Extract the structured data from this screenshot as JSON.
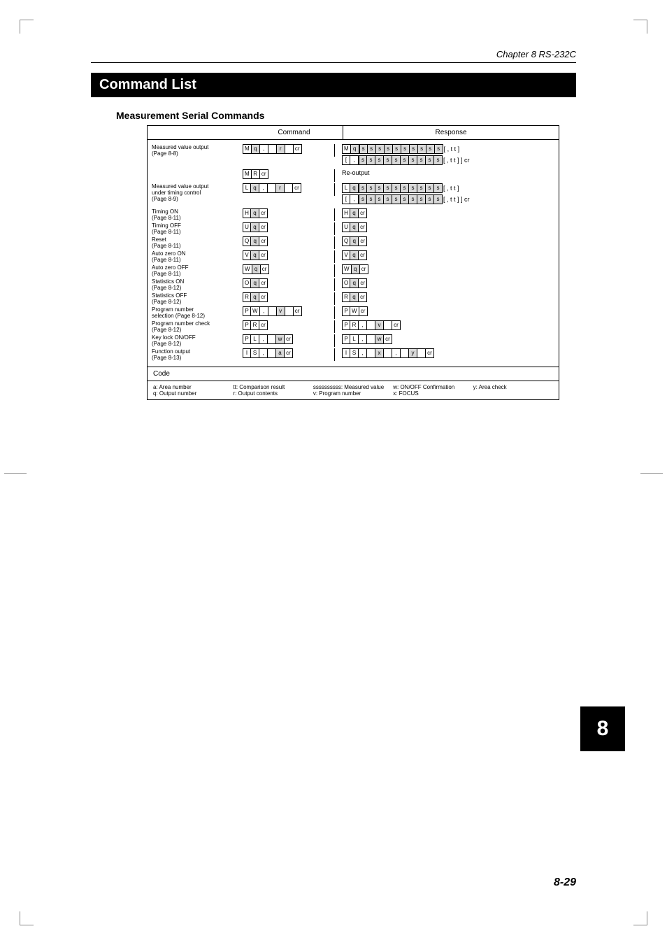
{
  "chapter": "Chapter 8  RS-232C",
  "title": "Command List",
  "subhead": "Measurement Serial Commands",
  "headers": {
    "cmd": "Command",
    "resp": "Response"
  },
  "rows": [
    {
      "label": "Measured value output\n(Page 8-8)",
      "cmd": [
        [
          "M"
        ],
        [
          "q"
        ],
        [
          ","
        ],
        [
          "sp"
        ],
        [
          "r"
        ],
        [
          "sp"
        ],
        [
          "cr"
        ]
      ],
      "cmd_shade": [
        0,
        1,
        0,
        0,
        1,
        0,
        0
      ],
      "resp_lines": [
        {
          "front": "M q",
          "pattern": "s10",
          "back": "[ , t t ]"
        },
        {
          "front": "[ ,",
          "pattern": "s10",
          "back": "[ , t t ] ] cr"
        }
      ]
    },
    {
      "label": "",
      "cmd": [
        [
          "M"
        ],
        [
          "R"
        ],
        [
          "cr"
        ]
      ],
      "cmd_shade": [
        0,
        0,
        0
      ],
      "resp_text": "Re-output"
    },
    {
      "label": "Measured value output\n  under timing control\n(Page 8-9)",
      "cmd": [
        [
          "L"
        ],
        [
          "q"
        ],
        [
          ","
        ],
        [
          "sp"
        ],
        [
          "r"
        ],
        [
          "sp"
        ],
        [
          "cr"
        ]
      ],
      "cmd_shade": [
        0,
        1,
        0,
        0,
        1,
        0,
        0
      ],
      "resp_lines": [
        {
          "front": "L q",
          "pattern": "s10",
          "back": "[ , t t ]"
        },
        {
          "front": "[ ,",
          "pattern": "s10",
          "back": "[ , t t ] ] cr"
        }
      ]
    },
    {
      "label": "Timing ON\n(Page 8-11)",
      "cmd": [
        [
          "H"
        ],
        [
          "q"
        ],
        [
          "cr"
        ]
      ],
      "cmd_shade": [
        0,
        1,
        0
      ],
      "resp": [
        [
          "H"
        ],
        [
          "q"
        ],
        [
          "cr"
        ]
      ],
      "resp_shade": [
        0,
        1,
        0
      ]
    },
    {
      "label": "Timing OFF\n(Page 8-11)",
      "cmd": [
        [
          "U"
        ],
        [
          "q"
        ],
        [
          "cr"
        ]
      ],
      "cmd_shade": [
        0,
        1,
        0
      ],
      "resp": [
        [
          "U"
        ],
        [
          "q"
        ],
        [
          "cr"
        ]
      ],
      "resp_shade": [
        0,
        1,
        0
      ]
    },
    {
      "label": "Reset\n(Page 8-11)",
      "cmd": [
        [
          "Q"
        ],
        [
          "q"
        ],
        [
          "cr"
        ]
      ],
      "cmd_shade": [
        0,
        1,
        0
      ],
      "resp": [
        [
          "Q"
        ],
        [
          "q"
        ],
        [
          "cr"
        ]
      ],
      "resp_shade": [
        0,
        1,
        0
      ]
    },
    {
      "label": "Auto zero ON\n(Page 8-11)",
      "cmd": [
        [
          "V"
        ],
        [
          "q"
        ],
        [
          "cr"
        ]
      ],
      "cmd_shade": [
        0,
        1,
        0
      ],
      "resp": [
        [
          "V"
        ],
        [
          "q"
        ],
        [
          "cr"
        ]
      ],
      "resp_shade": [
        0,
        1,
        0
      ]
    },
    {
      "label": "Auto zero OFF\n(Page 8-11)",
      "cmd": [
        [
          "W"
        ],
        [
          "q"
        ],
        [
          "cr"
        ]
      ],
      "cmd_shade": [
        0,
        1,
        0
      ],
      "resp": [
        [
          "W"
        ],
        [
          "q"
        ],
        [
          "cr"
        ]
      ],
      "resp_shade": [
        0,
        1,
        0
      ]
    },
    {
      "label": "Statistics ON\n(Page 8-12)",
      "cmd": [
        [
          "O"
        ],
        [
          "q"
        ],
        [
          "cr"
        ]
      ],
      "cmd_shade": [
        0,
        1,
        0
      ],
      "resp": [
        [
          "O"
        ],
        [
          "q"
        ],
        [
          "cr"
        ]
      ],
      "resp_shade": [
        0,
        1,
        0
      ]
    },
    {
      "label": "Statistics OFF\n(Page 8-12)",
      "cmd": [
        [
          "R"
        ],
        [
          "q"
        ],
        [
          "cr"
        ]
      ],
      "cmd_shade": [
        0,
        1,
        0
      ],
      "resp": [
        [
          "R"
        ],
        [
          "q"
        ],
        [
          "cr"
        ]
      ],
      "resp_shade": [
        0,
        1,
        0
      ]
    },
    {
      "label": "Program number\n  selection (Page 8-12)",
      "cmd": [
        [
          "P"
        ],
        [
          "W"
        ],
        [
          ","
        ],
        [
          "sp"
        ],
        [
          "v"
        ],
        [
          "sp"
        ],
        [
          "cr"
        ]
      ],
      "cmd_shade": [
        0,
        0,
        0,
        0,
        1,
        0,
        0
      ],
      "resp": [
        [
          "P"
        ],
        [
          "W"
        ],
        [
          "cr"
        ]
      ],
      "resp_shade": [
        0,
        0,
        0
      ]
    },
    {
      "label": "Program number check\n(Page 8-12)",
      "cmd": [
        [
          "P"
        ],
        [
          "R"
        ],
        [
          "cr"
        ]
      ],
      "cmd_shade": [
        0,
        0,
        0
      ],
      "resp": [
        [
          "P"
        ],
        [
          "R"
        ],
        [
          ","
        ],
        [
          "sp"
        ],
        [
          "v"
        ],
        [
          "sp"
        ],
        [
          "cr"
        ]
      ],
      "resp_shade": [
        0,
        0,
        0,
        0,
        1,
        0,
        0
      ]
    },
    {
      "label": "Key lock ON/OFF\n(Page 8-12)",
      "cmd": [
        [
          "P"
        ],
        [
          "L"
        ],
        [
          ","
        ],
        [
          "sp"
        ],
        [
          "w"
        ],
        [
          "cr"
        ]
      ],
      "cmd_shade": [
        0,
        0,
        0,
        0,
        1,
        0
      ],
      "resp": [
        [
          "P"
        ],
        [
          "L"
        ],
        [
          ","
        ],
        [
          "sp"
        ],
        [
          "w"
        ],
        [
          "cr"
        ]
      ],
      "resp_shade": [
        0,
        0,
        0,
        0,
        1,
        0
      ]
    },
    {
      "label": "Function output\n(Page 8-13)",
      "cmd": [
        [
          "I"
        ],
        [
          "S"
        ],
        [
          ","
        ],
        [
          "sp"
        ],
        [
          "a"
        ],
        [
          "cr"
        ]
      ],
      "cmd_shade": [
        0,
        0,
        0,
        0,
        1,
        0
      ],
      "resp": [
        [
          "I"
        ],
        [
          "S"
        ],
        [
          ","
        ],
        [
          "sp"
        ],
        [
          "x"
        ],
        [
          "sp"
        ],
        [
          ","
        ],
        [
          "sp"
        ],
        [
          "y"
        ],
        [
          "sp"
        ],
        [
          "cr"
        ]
      ],
      "resp_shade": [
        0,
        0,
        0,
        0,
        1,
        0,
        0,
        0,
        1,
        0,
        0
      ]
    }
  ],
  "code_header": "Code",
  "code": {
    "a": "a: Area number",
    "q": "q: Output number",
    "tt": "tt: Comparison result",
    "r": "r: Output contents",
    "s": "ssssssssss: Measured value",
    "v": "v: Program number",
    "w": "w: ON/OFF Confirmation",
    "x": "x: FOCUS",
    "y": "y: Area check"
  },
  "side_tab": "8",
  "page_number": "8-29"
}
